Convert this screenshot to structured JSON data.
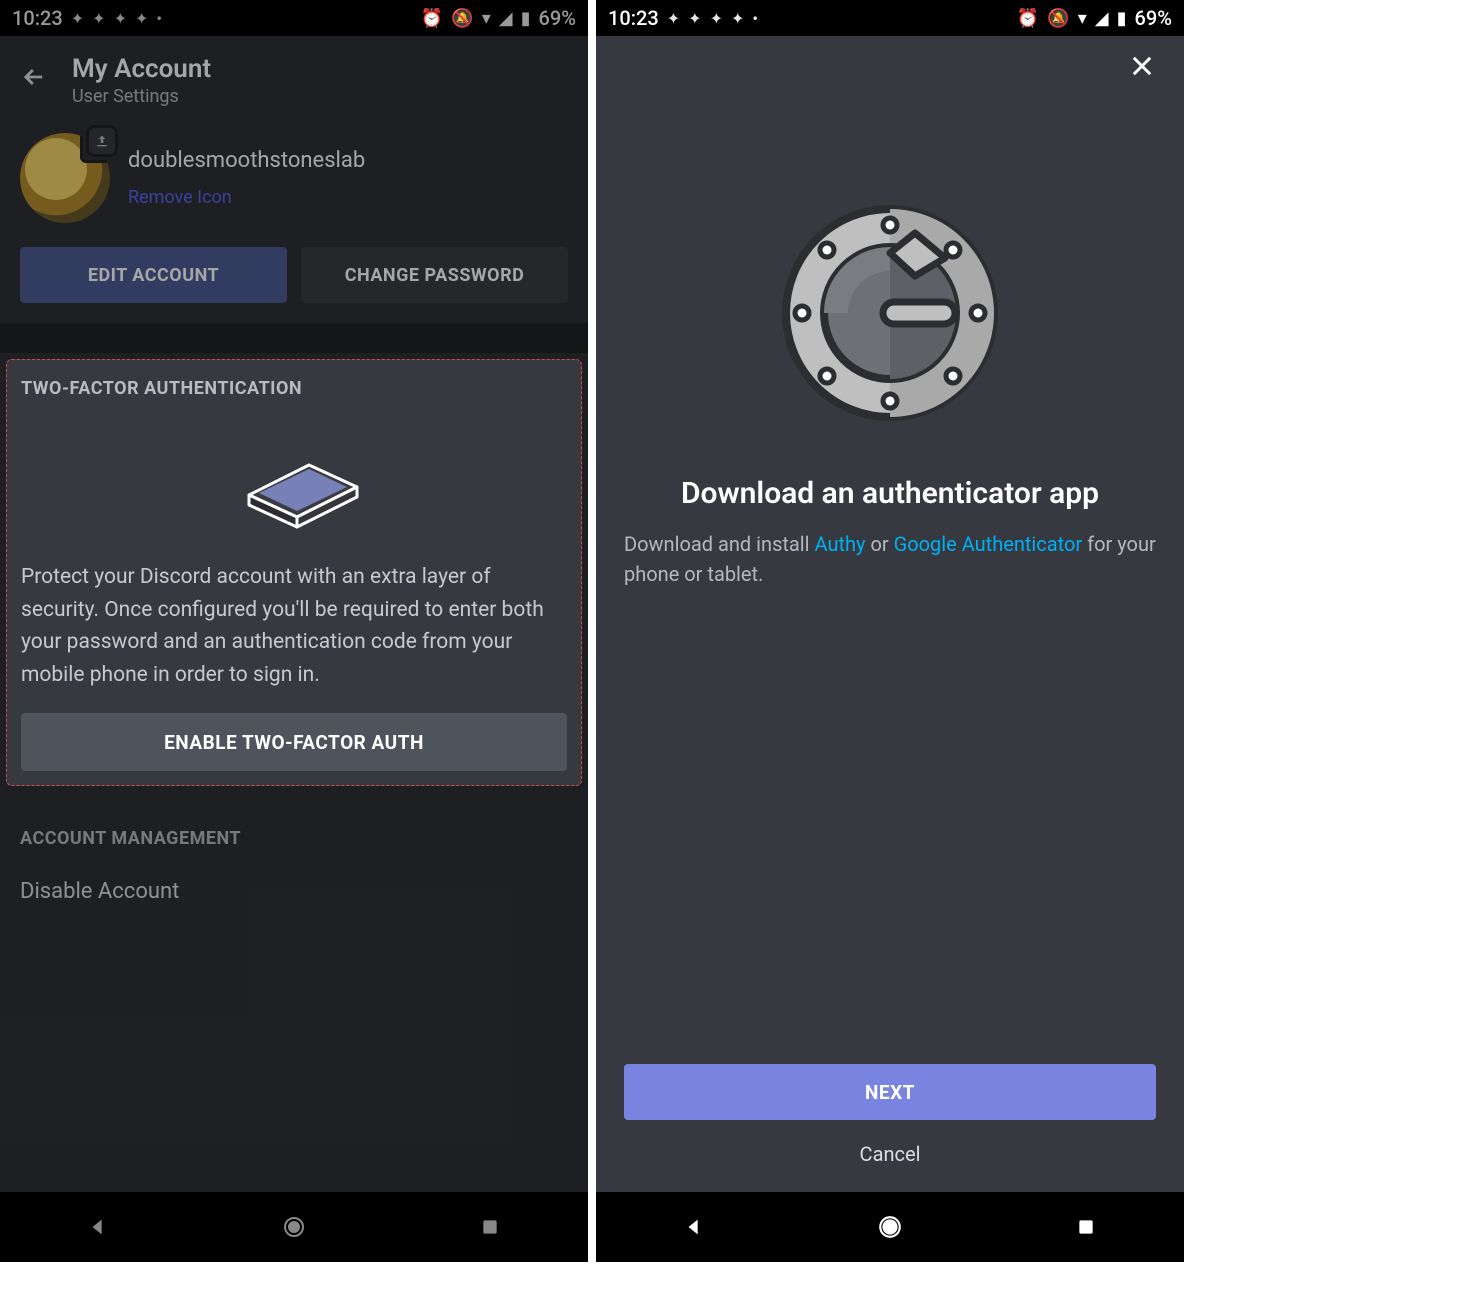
{
  "status": {
    "time": "10:23",
    "battery": "69%"
  },
  "left": {
    "header": {
      "title": "My Account",
      "subtitle": "User Settings"
    },
    "profile": {
      "username": "doublesmoothstoneslab",
      "remove": "Remove Icon"
    },
    "buttons": {
      "edit": "EDIT ACCOUNT",
      "change_pw": "CHANGE PASSWORD"
    },
    "tfa": {
      "label": "TWO-FACTOR AUTHENTICATION",
      "desc": "Protect your Discord account with an extra layer of security. Once configured you'll be required to enter both your password and an authentication code from your mobile phone in order to sign in.",
      "enable": "ENABLE TWO-FACTOR AUTH"
    },
    "account_mgmt": {
      "label": "ACCOUNT MANAGEMENT",
      "disable": "Disable Account"
    }
  },
  "right": {
    "title": "Download an authenticator app",
    "desc_pre": "Download and install ",
    "link1": "Authy",
    "desc_mid": " or ",
    "link2": "Google Authenticator",
    "desc_post": " for your phone or tablet.",
    "next": "NEXT",
    "cancel": "Cancel"
  }
}
